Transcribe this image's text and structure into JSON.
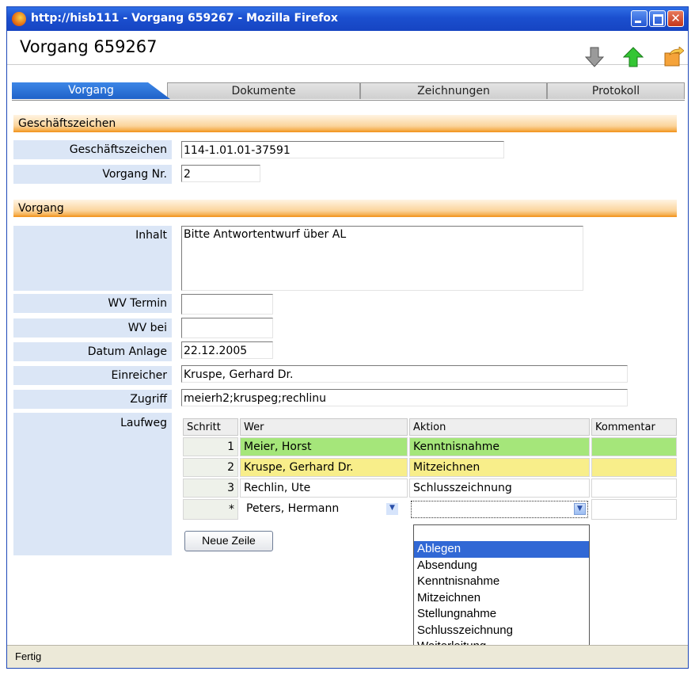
{
  "window": {
    "title": "http://hisb111 - Vorgang 659267 - Mozilla Firefox",
    "close_glyph": "✕"
  },
  "page": {
    "title": "Vorgang 659267"
  },
  "toolbar_icons": [
    "arrow-down-icon",
    "arrow-up-icon",
    "export-icon"
  ],
  "tabs": [
    {
      "label": "Vorgang",
      "active": true
    },
    {
      "label": "Dokumente",
      "active": false
    },
    {
      "label": "Zeichnungen",
      "active": false
    },
    {
      "label": "Protokoll",
      "active": false
    }
  ],
  "sections": {
    "geschaeftszeichen": "Geschäftszeichen",
    "vorgang": "Vorgang"
  },
  "fields": {
    "geschaeftszeichen": {
      "label": "Geschäftszeichen",
      "value": "114-1.01.01-37591"
    },
    "vorgang_nr": {
      "label": "Vorgang Nr.",
      "value": "2"
    },
    "inhalt": {
      "label": "Inhalt",
      "value": "Bitte Antwortentwurf über AL"
    },
    "wv_termin": {
      "label": "WV Termin",
      "value": ""
    },
    "wv_bei": {
      "label": "WV bei",
      "value": ""
    },
    "datum_anlage": {
      "label": "Datum Anlage",
      "value": "22.12.2005"
    },
    "einreicher": {
      "label": "Einreicher",
      "value": "Kruspe, Gerhard Dr."
    },
    "zugriff": {
      "label": "Zugriff",
      "value": "meierh2;kruspeg;rechlinu"
    }
  },
  "laufweg": {
    "label": "Laufweg",
    "columns": [
      "Schritt",
      "Wer",
      "Aktion",
      "Kommentar"
    ],
    "rows": [
      {
        "schritt": "1",
        "wer": "Meier, Horst",
        "aktion": "Kenntnisnahme",
        "kommentar": "",
        "color": "#a5e67a"
      },
      {
        "schritt": "2",
        "wer": "Kruspe, Gerhard Dr.",
        "aktion": "Mitzeichnen",
        "kommentar": "",
        "color": "#f8ee8a"
      },
      {
        "schritt": "3",
        "wer": "Rechlin, Ute",
        "aktion": "Schlusszeichnung",
        "kommentar": "",
        "color": "#ffffff"
      }
    ],
    "new_row": {
      "schritt": "*",
      "wer": "Peters, Hermann",
      "aktion": "",
      "kommentar": ""
    },
    "add_button": "Neue Zeile"
  },
  "aktion_options": [
    "",
    "Ablegen",
    "Absendung",
    "Kenntnisnahme",
    "Mitzeichnen",
    "Stellungnahme",
    "Schlusszeichnung",
    "Weiterleitung"
  ],
  "aktion_highlighted": "Ablegen",
  "status": "Fertig"
}
